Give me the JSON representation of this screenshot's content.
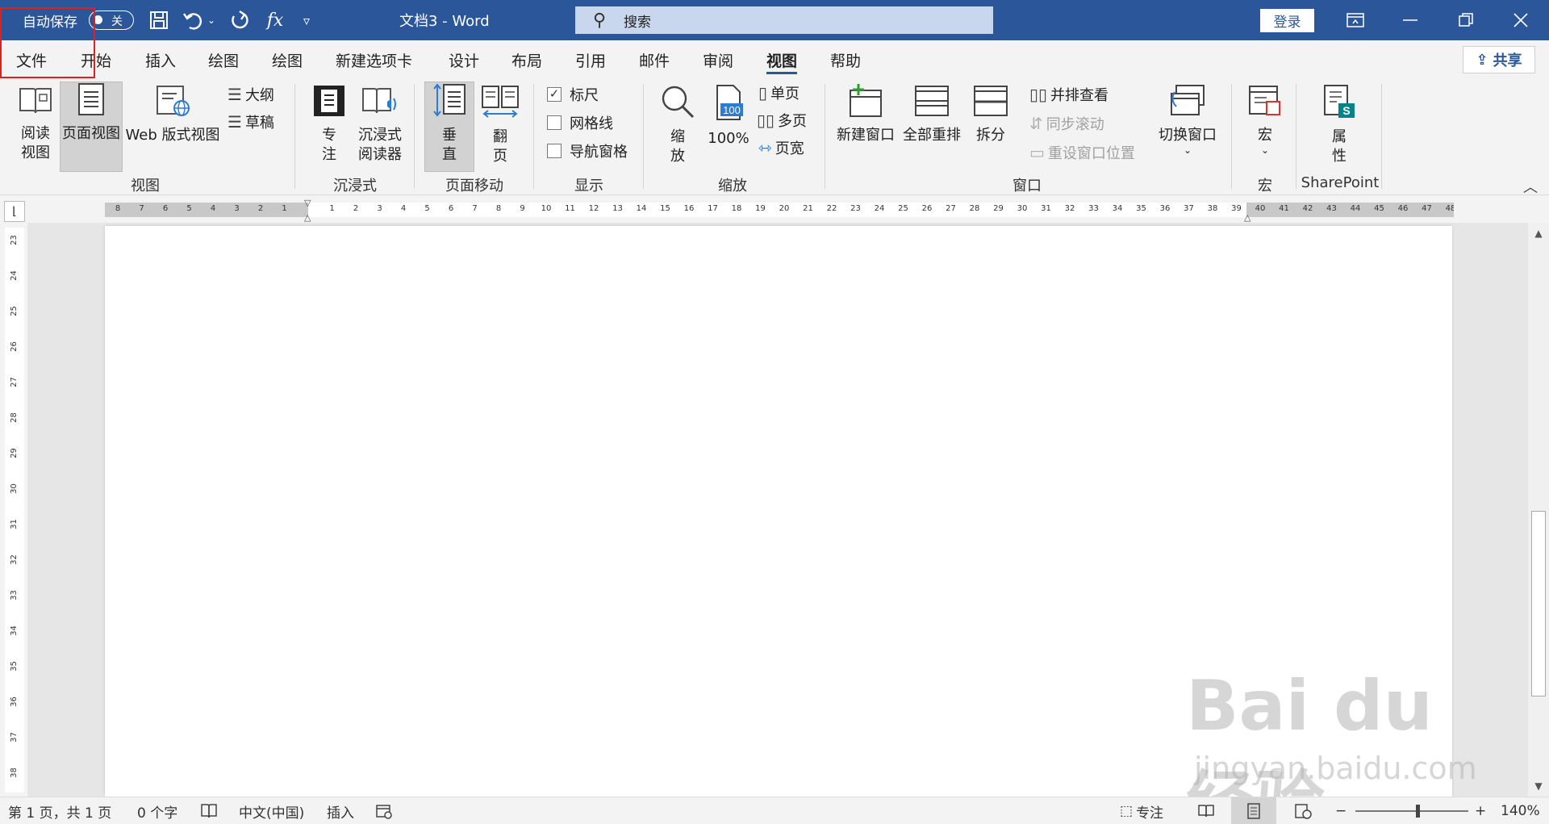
{
  "titlebar": {
    "autosave_label": "自动保存",
    "autosave_state": "关",
    "doc_title": "文档3  -  Word",
    "search_placeholder": "搜索",
    "login": "登录",
    "fx_label": "fx",
    "qat_icons": [
      "save-icon",
      "undo-icon",
      "redo-icon",
      "formula-icon",
      "customize-icon"
    ]
  },
  "tabs": [
    "文件",
    "开始",
    "插入",
    "绘图",
    "绘图",
    "新建选项卡",
    "设计",
    "布局",
    "引用",
    "邮件",
    "审阅",
    "视图",
    "帮助"
  ],
  "active_tab": "视图",
  "share_label": "共享",
  "ribbon": {
    "views": {
      "read": "阅读\n视图",
      "print": "页面视图",
      "web": "Web 版式视图",
      "outline": "大纲",
      "draft": "草稿",
      "group": "视图"
    },
    "immersive": {
      "focus": "专\n注",
      "reader": "沉浸式\n阅读器",
      "group": "沉浸式"
    },
    "page_move": {
      "vertical": "垂\n直",
      "flip": "翻\n页",
      "group": "页面移动"
    },
    "show": {
      "ruler": "标尺",
      "gridlines": "网格线",
      "nav": "导航窗格",
      "group": "显示",
      "ruler_checked": true
    },
    "zoom": {
      "zoom": "缩\n放",
      "hundred": "100%",
      "hundred_badge": "100",
      "one_page": "单页",
      "multi_page": "多页",
      "page_width": "页宽",
      "group": "缩放"
    },
    "window": {
      "new_window": "新建窗口",
      "arrange_all": "全部重排",
      "split": "拆分",
      "side_by_side": "并排查看",
      "sync_scroll": "同步滚动",
      "reset_pos": "重设窗口位置",
      "switch": "切换窗口",
      "group": "窗口"
    },
    "macros": {
      "macro": "宏",
      "group": "宏"
    },
    "sharepoint": {
      "properties": "属\n性",
      "group": "SharePoint"
    }
  },
  "hruler_numbers": [
    "8",
    "7",
    "6",
    "5",
    "4",
    "3",
    "2",
    "1",
    "",
    "1",
    "2",
    "3",
    "4",
    "5",
    "6",
    "7",
    "8",
    "9",
    "10",
    "11",
    "12",
    "13",
    "14",
    "15",
    "16",
    "17",
    "18",
    "19",
    "20",
    "21",
    "22",
    "23",
    "24",
    "25",
    "26",
    "27",
    "28",
    "29",
    "30",
    "31",
    "32",
    "33",
    "34",
    "35",
    "36",
    "37",
    "38",
    "39",
    "40",
    "41",
    "42",
    "43",
    "44",
    "45",
    "46",
    "47",
    "48"
  ],
  "vruler_numbers": [
    "23",
    "24",
    "25",
    "26",
    "27",
    "28",
    "29",
    "30",
    "31",
    "32",
    "33",
    "34",
    "35",
    "36",
    "37",
    "38"
  ],
  "status": {
    "page": "第 1 页，共 1 页",
    "words": "0 个字",
    "language": "中文(中国)",
    "insert": "插入",
    "focus": "专注",
    "zoom_minus": "−",
    "zoom_plus": "+",
    "zoom_pct": "140%",
    "zoom_level": 0.55
  },
  "watermark": {
    "brand": "Bai du 经验",
    "url": "jingyan.baidu.com"
  }
}
